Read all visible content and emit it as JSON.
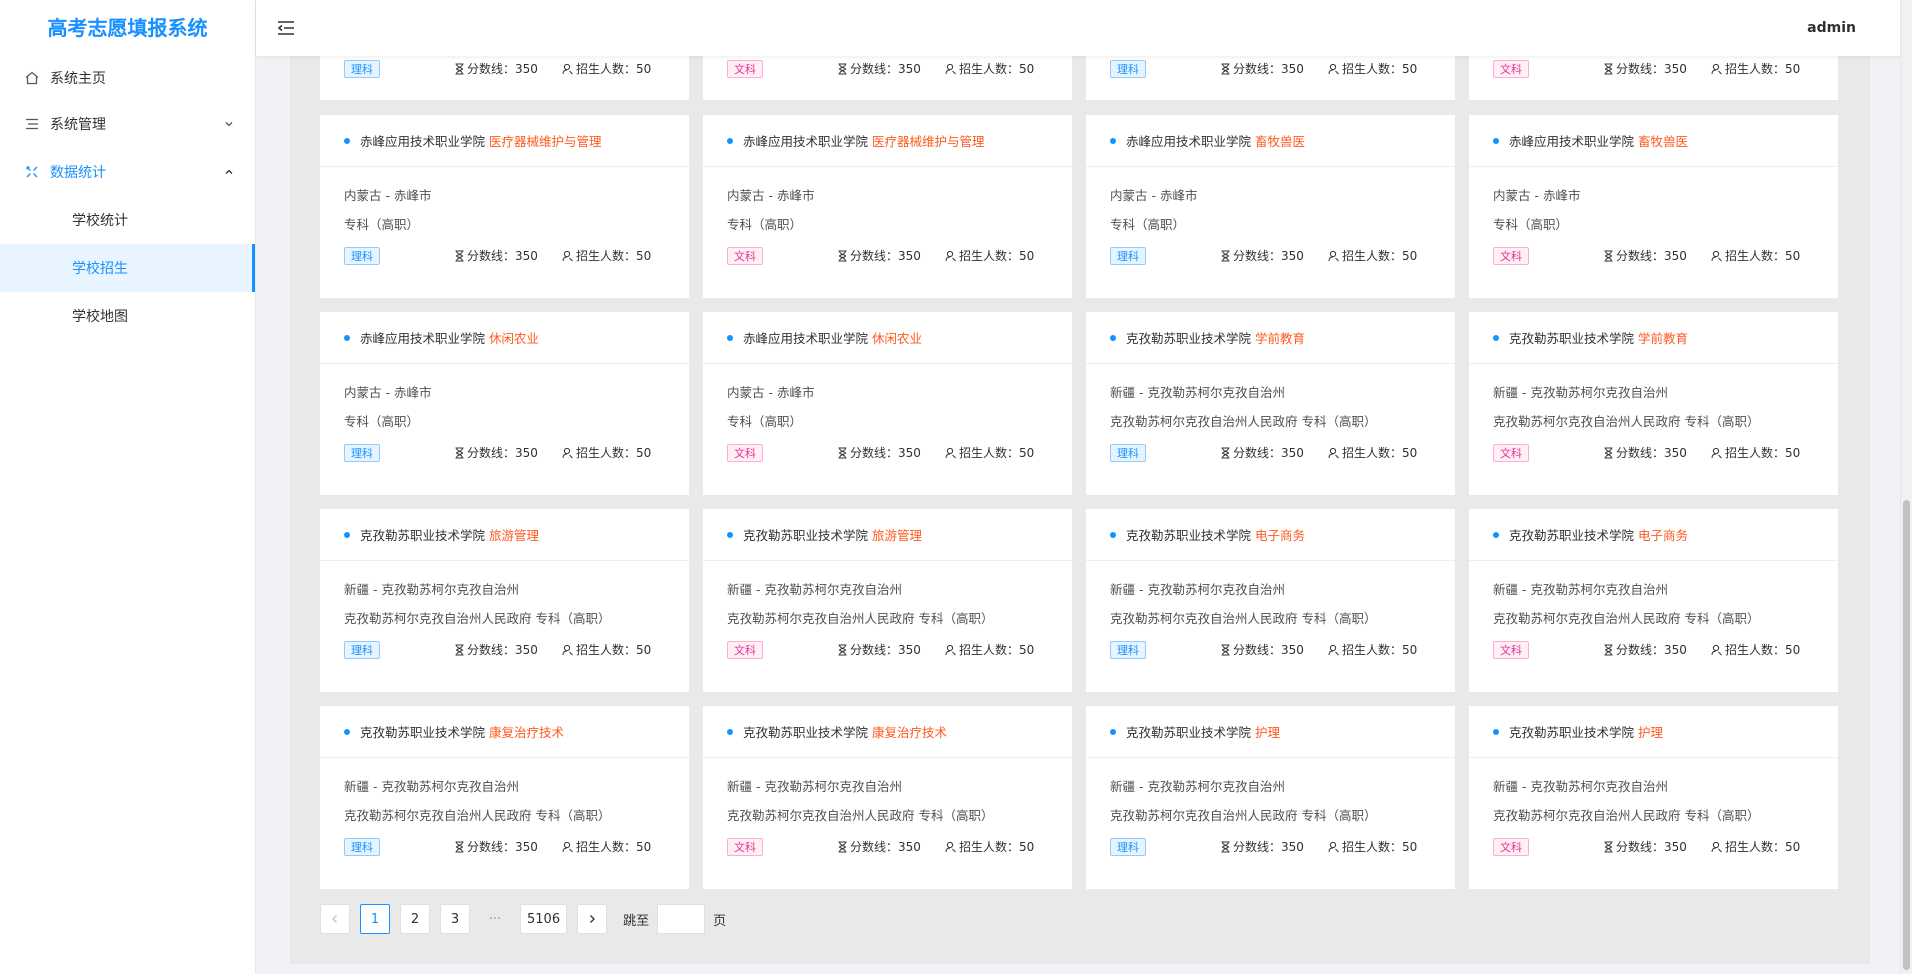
{
  "app": {
    "title": "高考志愿填报系统",
    "user": "admin"
  },
  "sidebar": {
    "items": [
      {
        "label": "系统主页",
        "icon": "home-icon"
      },
      {
        "label": "系统管理",
        "icon": "list-icon"
      },
      {
        "label": "数据统计",
        "icon": "stats-icon"
      }
    ],
    "subitems": [
      {
        "label": "学校统计"
      },
      {
        "label": "学校招生"
      },
      {
        "label": "学校地图"
      }
    ]
  },
  "labels": {
    "score_prefix": "分数线：",
    "enroll_prefix": "招生人数："
  },
  "partial_row": [
    {
      "type": "理科",
      "score": "350",
      "enroll": "50"
    },
    {
      "type": "文科",
      "score": "350",
      "enroll": "50"
    },
    {
      "type": "理科",
      "score": "350",
      "enroll": "50"
    },
    {
      "type": "文科",
      "score": "350",
      "enroll": "50"
    }
  ],
  "cards": [
    {
      "school": "赤峰应用技术职业学院",
      "major": "医疗器械维护与管理",
      "location": "内蒙古 - 赤峰市",
      "info": "专科（高职）",
      "type": "理科",
      "score": "350",
      "enroll": "50"
    },
    {
      "school": "赤峰应用技术职业学院",
      "major": "医疗器械维护与管理",
      "location": "内蒙古 - 赤峰市",
      "info": "专科（高职）",
      "type": "文科",
      "score": "350",
      "enroll": "50"
    },
    {
      "school": "赤峰应用技术职业学院",
      "major": "畜牧兽医",
      "location": "内蒙古 - 赤峰市",
      "info": "专科（高职）",
      "type": "理科",
      "score": "350",
      "enroll": "50"
    },
    {
      "school": "赤峰应用技术职业学院",
      "major": "畜牧兽医",
      "location": "内蒙古 - 赤峰市",
      "info": "专科（高职）",
      "type": "文科",
      "score": "350",
      "enroll": "50"
    },
    {
      "school": "赤峰应用技术职业学院",
      "major": "休闲农业",
      "location": "内蒙古 - 赤峰市",
      "info": "专科（高职）",
      "type": "理科",
      "score": "350",
      "enroll": "50"
    },
    {
      "school": "赤峰应用技术职业学院",
      "major": "休闲农业",
      "location": "内蒙古 - 赤峰市",
      "info": "专科（高职）",
      "type": "文科",
      "score": "350",
      "enroll": "50"
    },
    {
      "school": "克孜勒苏职业技术学院",
      "major": "学前教育",
      "location": "新疆 - 克孜勒苏柯尔克孜自治州",
      "info": "克孜勒苏柯尔克孜自治州人民政府 专科（高职）",
      "type": "理科",
      "score": "350",
      "enroll": "50"
    },
    {
      "school": "克孜勒苏职业技术学院",
      "major": "学前教育",
      "location": "新疆 - 克孜勒苏柯尔克孜自治州",
      "info": "克孜勒苏柯尔克孜自治州人民政府 专科（高职）",
      "type": "文科",
      "score": "350",
      "enroll": "50"
    },
    {
      "school": "克孜勒苏职业技术学院",
      "major": "旅游管理",
      "location": "新疆 - 克孜勒苏柯尔克孜自治州",
      "info": "克孜勒苏柯尔克孜自治州人民政府 专科（高职）",
      "type": "理科",
      "score": "350",
      "enroll": "50"
    },
    {
      "school": "克孜勒苏职业技术学院",
      "major": "旅游管理",
      "location": "新疆 - 克孜勒苏柯尔克孜自治州",
      "info": "克孜勒苏柯尔克孜自治州人民政府 专科（高职）",
      "type": "文科",
      "score": "350",
      "enroll": "50"
    },
    {
      "school": "克孜勒苏职业技术学院",
      "major": "电子商务",
      "location": "新疆 - 克孜勒苏柯尔克孜自治州",
      "info": "克孜勒苏柯尔克孜自治州人民政府 专科（高职）",
      "type": "理科",
      "score": "350",
      "enroll": "50"
    },
    {
      "school": "克孜勒苏职业技术学院",
      "major": "电子商务",
      "location": "新疆 - 克孜勒苏柯尔克孜自治州",
      "info": "克孜勒苏柯尔克孜自治州人民政府 专科（高职）",
      "type": "文科",
      "score": "350",
      "enroll": "50"
    },
    {
      "school": "克孜勒苏职业技术学院",
      "major": "康复治疗技术",
      "location": "新疆 - 克孜勒苏柯尔克孜自治州",
      "info": "克孜勒苏柯尔克孜自治州人民政府 专科（高职）",
      "type": "理科",
      "score": "350",
      "enroll": "50"
    },
    {
      "school": "克孜勒苏职业技术学院",
      "major": "康复治疗技术",
      "location": "新疆 - 克孜勒苏柯尔克孜自治州",
      "info": "克孜勒苏柯尔克孜自治州人民政府 专科（高职）",
      "type": "文科",
      "score": "350",
      "enroll": "50"
    },
    {
      "school": "克孜勒苏职业技术学院",
      "major": "护理",
      "location": "新疆 - 克孜勒苏柯尔克孜自治州",
      "info": "克孜勒苏柯尔克孜自治州人民政府 专科（高职）",
      "type": "理科",
      "score": "350",
      "enroll": "50"
    },
    {
      "school": "克孜勒苏职业技术学院",
      "major": "护理",
      "location": "新疆 - 克孜勒苏柯尔克孜自治州",
      "info": "克孜勒苏柯尔克孜自治州人民政府 专科（高职）",
      "type": "文科",
      "score": "350",
      "enroll": "50"
    }
  ],
  "pagination": {
    "pages": [
      "1",
      "2",
      "3"
    ],
    "ellipsis": "···",
    "last": "5106",
    "current": "1",
    "jump_label": "跳至",
    "page_suffix": "页"
  },
  "colors": {
    "accent": "#1890ff",
    "major": "#ff5a1f",
    "science_tag": "#1890ff",
    "arts_tag": "#eb2f96"
  }
}
